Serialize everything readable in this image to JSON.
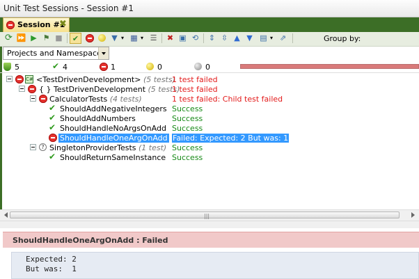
{
  "window": {
    "title": "Unit Test Sessions - Session #1"
  },
  "tab": {
    "label": "Session #1"
  },
  "toolbar": {
    "group_by_label": "Group by:"
  },
  "combo": {
    "value": "Projects and Namespaces"
  },
  "status": {
    "total": "5",
    "passed": "4",
    "failed": "1",
    "ignored": "0",
    "not_run": "0",
    "progress_fraction": 1.0
  },
  "tree": [
    {
      "name": "<TestDrivenDevelopment>",
      "count": "(5 tests)",
      "result": "1 test failed",
      "state": "fail"
    },
    {
      "name": "{ } TestDrivenDevelopment",
      "count": "(5 tests)",
      "result": "1 test failed",
      "state": "fail"
    },
    {
      "name": "CalculatorTests",
      "count": "(4 tests)",
      "result": "1 test failed: Child test failed",
      "state": "fail"
    },
    {
      "name": "ShouldAddNegativeIntegers",
      "count": "",
      "result": "Success",
      "state": "ok"
    },
    {
      "name": "ShouldAddNumbers",
      "count": "",
      "result": "Success",
      "state": "ok"
    },
    {
      "name": "ShouldHandleNoArgsOnAdd",
      "count": "",
      "result": "Success",
      "state": "ok"
    },
    {
      "name": "ShouldHandleOneArgOnAdd",
      "count": "",
      "result": "Failed:  Expected: 2 But was:  1",
      "state": "fail",
      "selected": true
    },
    {
      "name": "SingletonProviderTests",
      "count": "(1 test)",
      "result": "Success",
      "state": "ok"
    },
    {
      "name": "ShouldReturnSameInstance",
      "count": "",
      "result": "Success",
      "state": "ok"
    }
  ],
  "details": {
    "title": "ShouldHandleOneArgOnAdd : Failed",
    "body": "Expected: 2\nBut was:  1"
  }
}
